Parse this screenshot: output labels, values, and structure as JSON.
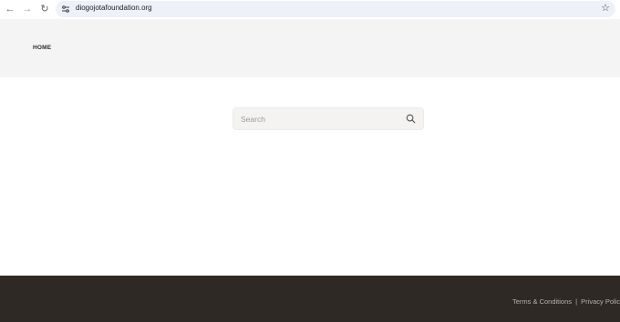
{
  "browser": {
    "url": "diogojotafoundation.org",
    "icons": {
      "back": "arrow-left-icon",
      "forward": "arrow-right-icon",
      "reload": "reload-icon",
      "site_info": "tune-icon",
      "bookmark": "star-icon"
    }
  },
  "header": {
    "nav": [
      {
        "label": "HOME"
      }
    ]
  },
  "search": {
    "placeholder": "Search",
    "value": "",
    "icon": "search-icon"
  },
  "footer": {
    "links": [
      {
        "label": "Terms & Conditions"
      },
      {
        "label": "Privacy Policy"
      }
    ],
    "separator": "|"
  },
  "colors": {
    "header_bg": "#f4f4f4",
    "search_bg": "#f5f3f1",
    "footer_bg": "#2f2925",
    "footer_text": "#b8b2ac"
  }
}
